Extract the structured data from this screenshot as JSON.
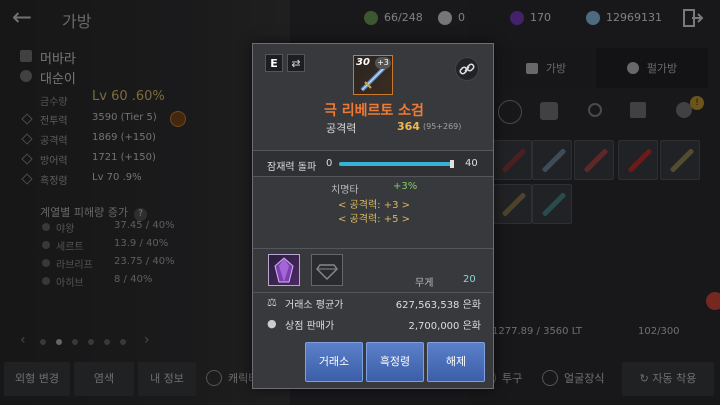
{
  "header": {
    "title": "가방",
    "resources": [
      {
        "icon": "energy-icon",
        "value": "66/248",
        "color": "#6fa05a"
      },
      {
        "icon": "pearl-icon",
        "value": "0",
        "color": "#d8d8d8"
      },
      {
        "icon": "crystal-icon",
        "value": "170",
        "color": "#7a3fc2"
      },
      {
        "icon": "silver-icon",
        "value": "12969131",
        "color": "#8cc3e8"
      }
    ]
  },
  "character": {
    "name": "머바라",
    "subname": "대순이",
    "level_label": "금수량",
    "level": "Lv 60 .60%",
    "stats": [
      {
        "label": "전투력",
        "value": "3590 (Tier 5)"
      },
      {
        "label": "공격력",
        "value": "1869 (+150)"
      },
      {
        "label": "방어력",
        "value": "1721 (+150)"
      },
      {
        "label": "흑정령",
        "value": "Lv 70 .9%"
      }
    ],
    "damage_title": "계열별 피해량 증가",
    "damage_rows": [
      {
        "label": "야왕",
        "value": "37.45 / 40%"
      },
      {
        "label": "세르트",
        "value": "13.9 / 40%"
      },
      {
        "label": "라브리프",
        "value": "23.75 / 40%"
      },
      {
        "label": "아히브",
        "value": "8 / 40%"
      }
    ]
  },
  "bottom_bar": {
    "tabs": [
      "외형 변경",
      "염색",
      "내 정보"
    ],
    "toggle_char": "캐릭터 정보",
    "toggle_helmet": "투구",
    "toggle_face": "얼굴장식",
    "auto_equip": "자동 착용"
  },
  "right_panel": {
    "tab_bag": "가방",
    "tab_extra": "펄가방",
    "lt_text": "1277.89 / 3560 LT",
    "capacity": "102/300",
    "notif_badge": "!"
  },
  "tooltip": {
    "badge": "E",
    "item_level": "30",
    "enhance": "+3",
    "item_name": "극 리베르토 소검",
    "attack_label": "공격력",
    "attack_value": "364",
    "attack_detail": "(95+269)",
    "breakthrough_label": "잠재력 돌파",
    "breakthrough_min": "0",
    "breakthrough_max": "40",
    "breakthrough_current": 40,
    "crit_label": "치명타",
    "crit_value": "+3%",
    "option_lines": [
      "< 공격력: +3 >",
      "< 공격력: +5 >"
    ],
    "weight_label": "무게",
    "weight_value": "20",
    "market_label": "거래소 평균가",
    "market_value": "627,563,538 은화",
    "shop_label": "상점 판매가",
    "shop_value": "2,700,000 은화",
    "buttons": {
      "market": "거래소",
      "black_spirit": "흑정령",
      "unequip": "해제"
    }
  }
}
